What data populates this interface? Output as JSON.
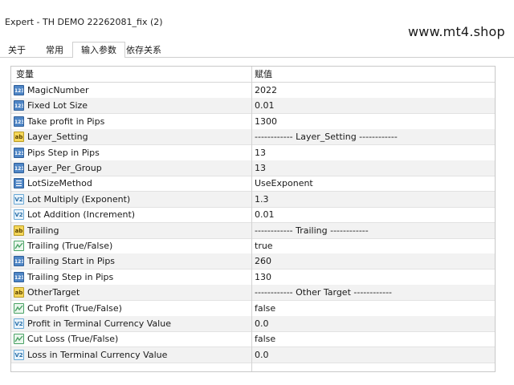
{
  "window": {
    "title": "Expert - TH DEMO 22262081_fix (2)"
  },
  "watermark": "www.mt4.shop",
  "tabs": [
    {
      "label": "关于"
    },
    {
      "label": "常用"
    },
    {
      "label": "输入参数"
    },
    {
      "label": "依存关系"
    }
  ],
  "table": {
    "headers": {
      "name": "变量",
      "value": "赋值"
    },
    "rows": [
      {
        "icon": "int-icon",
        "name": "MagicNumber",
        "value": "2022"
      },
      {
        "icon": "int-icon",
        "name": "Fixed Lot Size",
        "value": "0.01"
      },
      {
        "icon": "int-icon",
        "name": "Take profit in Pips",
        "value": "1300"
      },
      {
        "icon": "string-icon",
        "name": "Layer_Setting",
        "value": "------------ Layer_Setting ------------"
      },
      {
        "icon": "int-icon",
        "name": "Pips Step in Pips",
        "value": "13"
      },
      {
        "icon": "int-icon",
        "name": "Layer_Per_Group",
        "value": "13"
      },
      {
        "icon": "enum-icon",
        "name": "LotSizeMethod",
        "value": "UseExponent"
      },
      {
        "icon": "double-icon",
        "name": "Lot Multiply (Exponent)",
        "value": "1.3"
      },
      {
        "icon": "double-icon",
        "name": "Lot Addition (Increment)",
        "value": "0.01"
      },
      {
        "icon": "string-icon",
        "name": "Trailing",
        "value": "------------ Trailing ------------"
      },
      {
        "icon": "bool-icon",
        "name": "Trailing (True/False)",
        "value": "true"
      },
      {
        "icon": "int-icon",
        "name": "Trailing Start in Pips",
        "value": "260"
      },
      {
        "icon": "int-icon",
        "name": "Trailing Step in Pips",
        "value": "130"
      },
      {
        "icon": "string-icon",
        "name": "OtherTarget",
        "value": "------------ Other Target ------------"
      },
      {
        "icon": "bool-icon",
        "name": "Cut Profit (True/False)",
        "value": "false"
      },
      {
        "icon": "double-icon",
        "name": "Profit in Terminal Currency Value",
        "value": "0.0"
      },
      {
        "icon": "bool-icon",
        "name": "Cut Loss (True/False)",
        "value": "false"
      },
      {
        "icon": "double-icon",
        "name": "Loss in Terminal Currency Value",
        "value": "0.0"
      }
    ]
  },
  "icon_text": {
    "int": "123",
    "string": "ab",
    "double": "V2"
  },
  "colors": {
    "int": "#4f86c6",
    "string": "#f5d75a",
    "double": "#6aa9d6",
    "bool": "#4aa265",
    "grid_alt_row": "#f2f2f2"
  }
}
